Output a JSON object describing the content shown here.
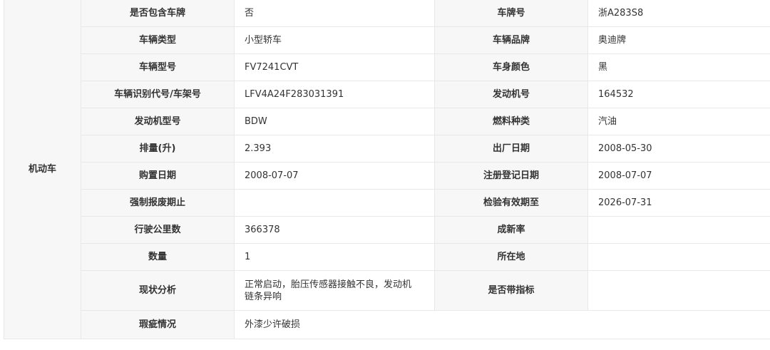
{
  "category": "机动车",
  "rows": [
    {
      "l1": "是否包含车牌",
      "v1": "否",
      "l2": "车牌号",
      "v2": "浙A283S8"
    },
    {
      "l1": "车辆类型",
      "v1": "小型轿车",
      "l2": "车辆品牌",
      "v2": "奥迪牌"
    },
    {
      "l1": "车辆型号",
      "v1": "FV7241CVT",
      "l2": "车身颜色",
      "v2": "黑"
    },
    {
      "l1": "车辆识别代号/车架号",
      "v1": "LFV4A24F283031391",
      "l2": "发动机号",
      "v2": "164532"
    },
    {
      "l1": "发动机型号",
      "v1": "BDW",
      "l2": "燃料种类",
      "v2": "汽油"
    },
    {
      "l1": "排量(升)",
      "v1": "2.393",
      "l2": "出厂日期",
      "v2": "2008-05-30"
    },
    {
      "l1": "购置日期",
      "v1": "2008-07-07",
      "l2": "注册登记日期",
      "v2": "2008-07-07"
    },
    {
      "l1": "强制报废期止",
      "v1": "",
      "l2": "检验有效期至",
      "v2": "2026-07-31"
    },
    {
      "l1": "行驶公里数",
      "v1": "366378",
      "l2": "成新率",
      "v2": ""
    },
    {
      "l1": "数量",
      "v1": "1",
      "l2": "所在地",
      "v2": ""
    },
    {
      "l1": "现状分析",
      "v1": "正常启动，胎压传感器接触不良，发动机链条异响",
      "l2": "是否带指标",
      "v2": ""
    },
    {
      "l1": "瑕疵情况",
      "v1": "外漆少许破损"
    }
  ]
}
